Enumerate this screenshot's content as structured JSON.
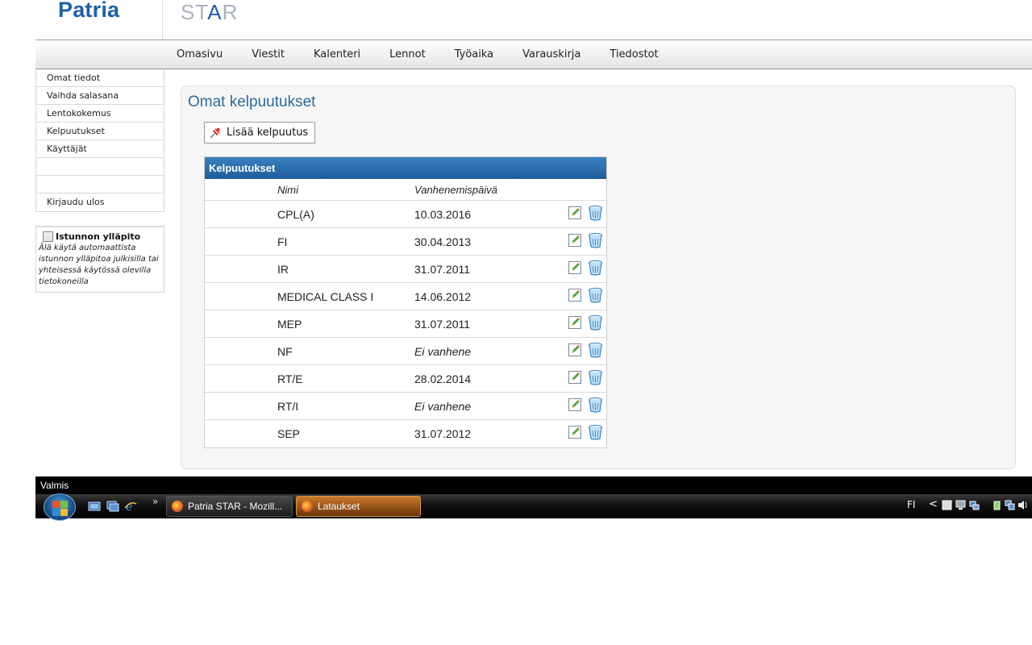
{
  "header": {
    "logo_text": "Patria",
    "product_logo_prefix": "ST",
    "product_logo_accent": "A",
    "product_logo_suffix": "R"
  },
  "topnav": {
    "items": [
      "Omasivu",
      "Viestit",
      "Kalenteri",
      "Lennot",
      "Työaika",
      "Varauskirja",
      "Tiedostot"
    ]
  },
  "sidebar": {
    "items": [
      "Omat tiedot",
      "Vaihda salasana",
      "Lentokokemus",
      "Kelpuutukset",
      "Käyttäjät",
      "",
      "",
      "Kirjaudu ulos"
    ]
  },
  "session": {
    "title": "Istunnon ylläpito",
    "description": "Älä käytä automaattista istunnon ylläpitoa julkisilla tai yhteisessä käytössä olevilla tietokoneilla"
  },
  "main": {
    "title": "Omat kelpuutukset",
    "add_button_label": "Lisää kelpuutus",
    "table": {
      "title": "Kelpuutukset",
      "columns": [
        "Nimi",
        "Vanhenemispäivä"
      ],
      "rows": [
        {
          "name": "CPL(A)",
          "expiry": "10.03.2016"
        },
        {
          "name": "FI",
          "expiry": "30.04.2013"
        },
        {
          "name": "IR",
          "expiry": "31.07.2011"
        },
        {
          "name": "MEDICAL CLASS I",
          "expiry": "14.06.2012"
        },
        {
          "name": "MEP",
          "expiry": "31.07.2011"
        },
        {
          "name": "NF",
          "expiry": "Ei vanhene"
        },
        {
          "name": "RT/E",
          "expiry": "28.02.2014"
        },
        {
          "name": "RT/I",
          "expiry": "Ei vanhene"
        },
        {
          "name": "SEP",
          "expiry": "31.07.2012"
        }
      ]
    }
  },
  "statusbar": {
    "text": "Valmis"
  },
  "taskbar": {
    "chevron": "»",
    "buttons": [
      "Patria STAR - Mozill...",
      "Lataukset"
    ],
    "tray_language": "FI",
    "tray_chevron": "<"
  },
  "colors": {
    "brand_blue": "#1f5fa8",
    "title_blue": "#2b6b9e",
    "table_header": "#2a6eae"
  }
}
